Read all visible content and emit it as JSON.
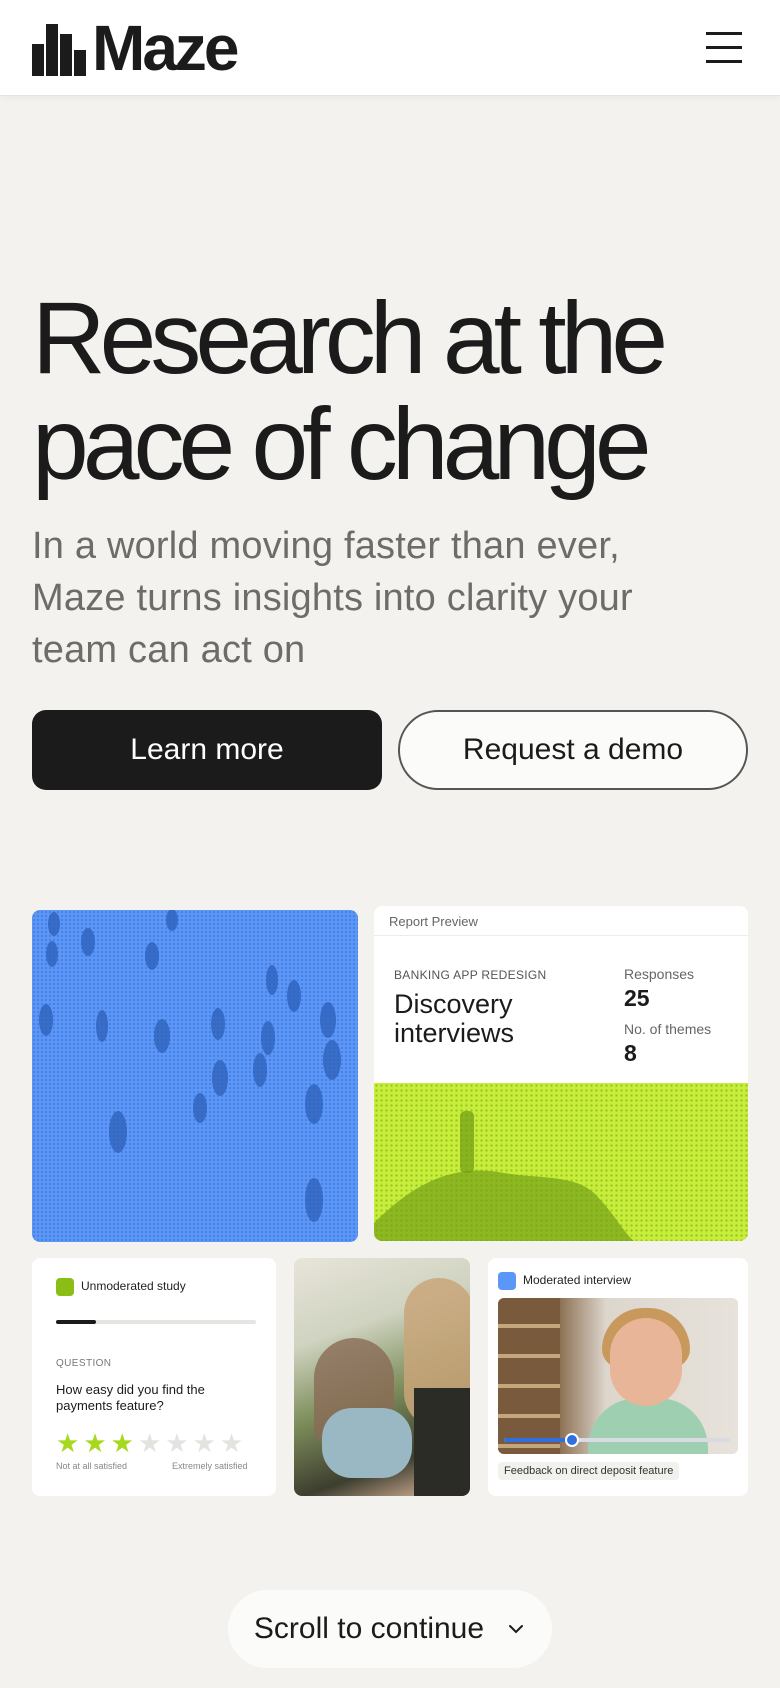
{
  "header": {
    "brand": "Maze",
    "logo_icon": "maze-logo-mark",
    "menu_icon": "hamburger-menu-icon"
  },
  "hero": {
    "title_line1": "Research at the",
    "title_line2": "pace of change",
    "subtitle": "In a world moving faster than ever, Maze turns insights into clarity your team can act on",
    "primary_cta": "Learn more",
    "secondary_cta": "Request a demo"
  },
  "showcase": {
    "report": {
      "header": "Report Preview",
      "tag": "BANKING APP REDESIGN",
      "title": "Discovery interviews",
      "stats": [
        {
          "label": "Responses",
          "value": "25"
        },
        {
          "label": "No. of themes",
          "value": "8"
        }
      ]
    },
    "unmoderated": {
      "title": "Unmoderated study",
      "progress": 0.2,
      "question_label": "QUESTION",
      "question": "How easy did you find the payments feature?",
      "rating": 3,
      "rating_max": 7,
      "scale_low": "Not at all satisfied",
      "scale_high": "Extremely satisfied"
    },
    "moderated": {
      "title": "Moderated interview",
      "video_progress": 0.3,
      "caption": "Feedback on direct deposit feature"
    }
  },
  "scroll": {
    "label": "Scroll to continue",
    "icon": "chevron-down-icon"
  },
  "colors": {
    "accent_dark": "#1b1b1b",
    "blue": "#5a97f8",
    "lime": "#c7ee3a",
    "star_active": "#a6d91e",
    "star_inactive": "#e3e3e0"
  }
}
